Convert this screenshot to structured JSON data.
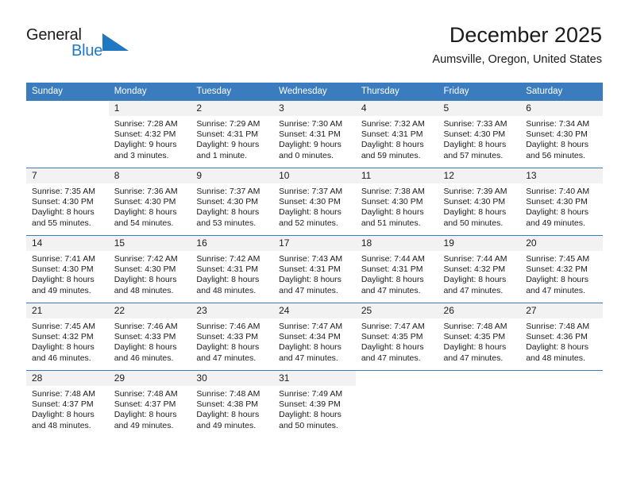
{
  "brand": {
    "name_part1": "General",
    "name_part2": "Blue",
    "accent_color": "#1f78c1",
    "triangle_icon": "triangle-right-icon"
  },
  "header": {
    "title": "December 2025",
    "subtitle": "Aumsville, Oregon, United States"
  },
  "calendar": {
    "header_bg": "#3a7cbe",
    "weekday_headers": [
      "Sunday",
      "Monday",
      "Tuesday",
      "Wednesday",
      "Thursday",
      "Friday",
      "Saturday"
    ],
    "weeks": [
      [
        {
          "day": "",
          "sunrise": "",
          "sunset": "",
          "daylight_line1": "",
          "daylight_line2": "",
          "blank": true
        },
        {
          "day": "1",
          "sunrise": "Sunrise: 7:28 AM",
          "sunset": "Sunset: 4:32 PM",
          "daylight_line1": "Daylight: 9 hours",
          "daylight_line2": "and 3 minutes."
        },
        {
          "day": "2",
          "sunrise": "Sunrise: 7:29 AM",
          "sunset": "Sunset: 4:31 PM",
          "daylight_line1": "Daylight: 9 hours",
          "daylight_line2": "and 1 minute."
        },
        {
          "day": "3",
          "sunrise": "Sunrise: 7:30 AM",
          "sunset": "Sunset: 4:31 PM",
          "daylight_line1": "Daylight: 9 hours",
          "daylight_line2": "and 0 minutes."
        },
        {
          "day": "4",
          "sunrise": "Sunrise: 7:32 AM",
          "sunset": "Sunset: 4:31 PM",
          "daylight_line1": "Daylight: 8 hours",
          "daylight_line2": "and 59 minutes."
        },
        {
          "day": "5",
          "sunrise": "Sunrise: 7:33 AM",
          "sunset": "Sunset: 4:30 PM",
          "daylight_line1": "Daylight: 8 hours",
          "daylight_line2": "and 57 minutes."
        },
        {
          "day": "6",
          "sunrise": "Sunrise: 7:34 AM",
          "sunset": "Sunset: 4:30 PM",
          "daylight_line1": "Daylight: 8 hours",
          "daylight_line2": "and 56 minutes."
        }
      ],
      [
        {
          "day": "7",
          "sunrise": "Sunrise: 7:35 AM",
          "sunset": "Sunset: 4:30 PM",
          "daylight_line1": "Daylight: 8 hours",
          "daylight_line2": "and 55 minutes."
        },
        {
          "day": "8",
          "sunrise": "Sunrise: 7:36 AM",
          "sunset": "Sunset: 4:30 PM",
          "daylight_line1": "Daylight: 8 hours",
          "daylight_line2": "and 54 minutes."
        },
        {
          "day": "9",
          "sunrise": "Sunrise: 7:37 AM",
          "sunset": "Sunset: 4:30 PM",
          "daylight_line1": "Daylight: 8 hours",
          "daylight_line2": "and 53 minutes."
        },
        {
          "day": "10",
          "sunrise": "Sunrise: 7:37 AM",
          "sunset": "Sunset: 4:30 PM",
          "daylight_line1": "Daylight: 8 hours",
          "daylight_line2": "and 52 minutes."
        },
        {
          "day": "11",
          "sunrise": "Sunrise: 7:38 AM",
          "sunset": "Sunset: 4:30 PM",
          "daylight_line1": "Daylight: 8 hours",
          "daylight_line2": "and 51 minutes."
        },
        {
          "day": "12",
          "sunrise": "Sunrise: 7:39 AM",
          "sunset": "Sunset: 4:30 PM",
          "daylight_line1": "Daylight: 8 hours",
          "daylight_line2": "and 50 minutes."
        },
        {
          "day": "13",
          "sunrise": "Sunrise: 7:40 AM",
          "sunset": "Sunset: 4:30 PM",
          "daylight_line1": "Daylight: 8 hours",
          "daylight_line2": "and 49 minutes."
        }
      ],
      [
        {
          "day": "14",
          "sunrise": "Sunrise: 7:41 AM",
          "sunset": "Sunset: 4:30 PM",
          "daylight_line1": "Daylight: 8 hours",
          "daylight_line2": "and 49 minutes."
        },
        {
          "day": "15",
          "sunrise": "Sunrise: 7:42 AM",
          "sunset": "Sunset: 4:30 PM",
          "daylight_line1": "Daylight: 8 hours",
          "daylight_line2": "and 48 minutes."
        },
        {
          "day": "16",
          "sunrise": "Sunrise: 7:42 AM",
          "sunset": "Sunset: 4:31 PM",
          "daylight_line1": "Daylight: 8 hours",
          "daylight_line2": "and 48 minutes."
        },
        {
          "day": "17",
          "sunrise": "Sunrise: 7:43 AM",
          "sunset": "Sunset: 4:31 PM",
          "daylight_line1": "Daylight: 8 hours",
          "daylight_line2": "and 47 minutes."
        },
        {
          "day": "18",
          "sunrise": "Sunrise: 7:44 AM",
          "sunset": "Sunset: 4:31 PM",
          "daylight_line1": "Daylight: 8 hours",
          "daylight_line2": "and 47 minutes."
        },
        {
          "day": "19",
          "sunrise": "Sunrise: 7:44 AM",
          "sunset": "Sunset: 4:32 PM",
          "daylight_line1": "Daylight: 8 hours",
          "daylight_line2": "and 47 minutes."
        },
        {
          "day": "20",
          "sunrise": "Sunrise: 7:45 AM",
          "sunset": "Sunset: 4:32 PM",
          "daylight_line1": "Daylight: 8 hours",
          "daylight_line2": "and 47 minutes."
        }
      ],
      [
        {
          "day": "21",
          "sunrise": "Sunrise: 7:45 AM",
          "sunset": "Sunset: 4:32 PM",
          "daylight_line1": "Daylight: 8 hours",
          "daylight_line2": "and 46 minutes."
        },
        {
          "day": "22",
          "sunrise": "Sunrise: 7:46 AM",
          "sunset": "Sunset: 4:33 PM",
          "daylight_line1": "Daylight: 8 hours",
          "daylight_line2": "and 46 minutes."
        },
        {
          "day": "23",
          "sunrise": "Sunrise: 7:46 AM",
          "sunset": "Sunset: 4:33 PM",
          "daylight_line1": "Daylight: 8 hours",
          "daylight_line2": "and 47 minutes."
        },
        {
          "day": "24",
          "sunrise": "Sunrise: 7:47 AM",
          "sunset": "Sunset: 4:34 PM",
          "daylight_line1": "Daylight: 8 hours",
          "daylight_line2": "and 47 minutes."
        },
        {
          "day": "25",
          "sunrise": "Sunrise: 7:47 AM",
          "sunset": "Sunset: 4:35 PM",
          "daylight_line1": "Daylight: 8 hours",
          "daylight_line2": "and 47 minutes."
        },
        {
          "day": "26",
          "sunrise": "Sunrise: 7:48 AM",
          "sunset": "Sunset: 4:35 PM",
          "daylight_line1": "Daylight: 8 hours",
          "daylight_line2": "and 47 minutes."
        },
        {
          "day": "27",
          "sunrise": "Sunrise: 7:48 AM",
          "sunset": "Sunset: 4:36 PM",
          "daylight_line1": "Daylight: 8 hours",
          "daylight_line2": "and 48 minutes."
        }
      ],
      [
        {
          "day": "28",
          "sunrise": "Sunrise: 7:48 AM",
          "sunset": "Sunset: 4:37 PM",
          "daylight_line1": "Daylight: 8 hours",
          "daylight_line2": "and 48 minutes."
        },
        {
          "day": "29",
          "sunrise": "Sunrise: 7:48 AM",
          "sunset": "Sunset: 4:37 PM",
          "daylight_line1": "Daylight: 8 hours",
          "daylight_line2": "and 49 minutes."
        },
        {
          "day": "30",
          "sunrise": "Sunrise: 7:48 AM",
          "sunset": "Sunset: 4:38 PM",
          "daylight_line1": "Daylight: 8 hours",
          "daylight_line2": "and 49 minutes."
        },
        {
          "day": "31",
          "sunrise": "Sunrise: 7:49 AM",
          "sunset": "Sunset: 4:39 PM",
          "daylight_line1": "Daylight: 8 hours",
          "daylight_line2": "and 50 minutes."
        },
        {
          "day": "",
          "sunrise": "",
          "sunset": "",
          "daylight_line1": "",
          "daylight_line2": "",
          "blank": true
        },
        {
          "day": "",
          "sunrise": "",
          "sunset": "",
          "daylight_line1": "",
          "daylight_line2": "",
          "blank": true
        },
        {
          "day": "",
          "sunrise": "",
          "sunset": "",
          "daylight_line1": "",
          "daylight_line2": "",
          "blank": true
        }
      ]
    ]
  }
}
